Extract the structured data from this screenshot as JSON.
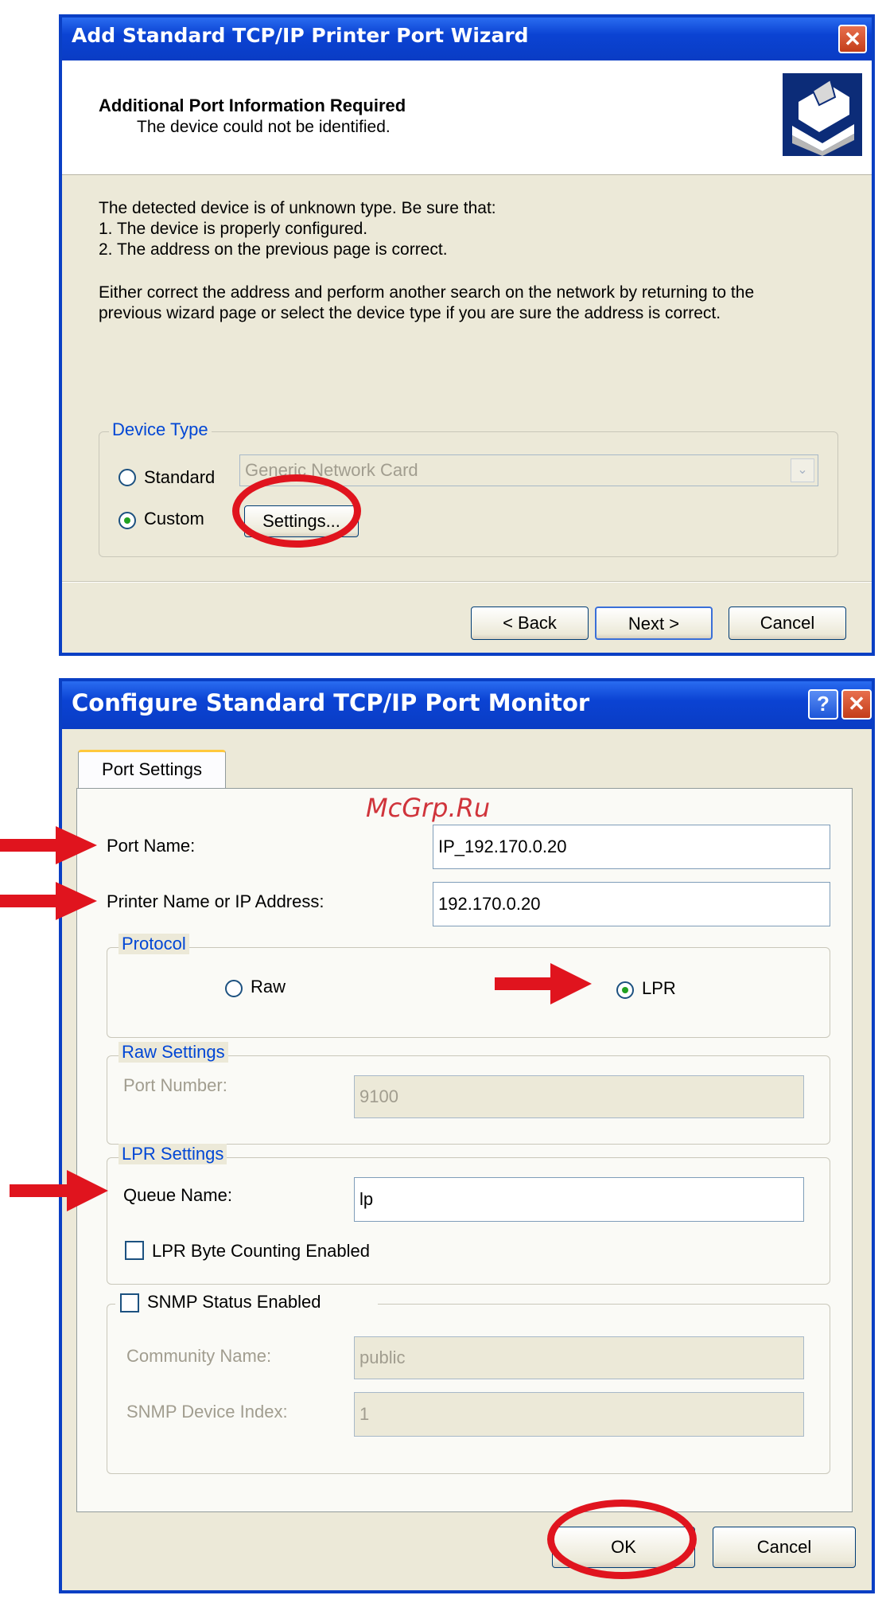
{
  "wizard": {
    "title": "Add Standard TCP/IP Printer Port Wizard",
    "close_glyph": "✕",
    "header_title": "Additional Port Information Required",
    "header_subtitle": "The device could not be identified.",
    "body_line1": "The detected device is of unknown type.  Be sure that:",
    "body_line2": "1. The device is properly configured.",
    "body_line3": "2.  The address on the previous page is correct.",
    "body_para2_line1": "Either correct the address and perform another search on the network by returning to the",
    "body_para2_line2": "previous wizard page or select the device type if you are sure the address is correct.",
    "device_type_legend": "Device Type",
    "standard_label": "Standard",
    "custom_label": "Custom",
    "standard_select_value": "Generic Network Card",
    "settings_button": "Settings...",
    "back_button": "< Back",
    "next_button": "Next >",
    "cancel_button": "Cancel",
    "selected_radio": "Custom"
  },
  "monitor": {
    "title": "Configure Standard TCP/IP Port Monitor",
    "help_glyph": "?",
    "close_glyph": "✕",
    "tab_label": "Port Settings",
    "port_name_label": "Port Name:",
    "port_name_value": "IP_192.170.0.20",
    "printer_name_label": "Printer Name or IP Address:",
    "printer_name_value": "192.170.0.20",
    "protocol_legend": "Protocol",
    "raw_label": "Raw",
    "lpr_label": "LPR",
    "selected_protocol": "LPR",
    "raw_settings_legend": "Raw Settings",
    "port_number_label": "Port Number:",
    "port_number_value": "9100",
    "lpr_settings_legend": "LPR Settings",
    "queue_name_label": "Queue Name:",
    "queue_name_value": "lp",
    "lpr_byte_counting_label": "LPR Byte Counting Enabled",
    "lpr_byte_counting_checked": false,
    "snmp_label": "SNMP Status Enabled",
    "snmp_checked": false,
    "community_name_label": "Community Name:",
    "community_name_value": "public",
    "snmp_device_index_label": "SNMP Device Index:",
    "snmp_device_index_value": "1",
    "ok_button": "OK",
    "cancel_button": "Cancel"
  },
  "watermark": "McGrp.Ru",
  "colors": {
    "title_blue": "#0a3fc4",
    "annotation_red": "#e0141e",
    "dialog_bg": "#ece9d8"
  }
}
